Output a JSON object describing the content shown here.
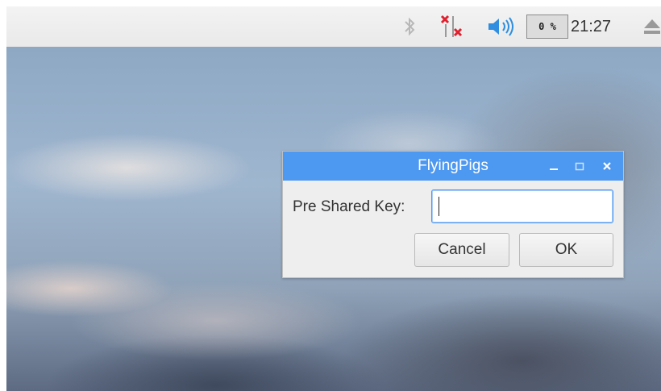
{
  "panel": {
    "bluetooth_icon": "bluetooth-icon",
    "network_icon": "network-disconnected-icon",
    "volume_icon": "volume-icon",
    "cpu_usage": "0 %",
    "clock": "21:27",
    "eject_icon": "eject-icon",
    "colors": {
      "network_x": "#e0202e",
      "volume": "#2f8ee0",
      "panel_bg": "#efefef"
    }
  },
  "dialog": {
    "title": "FlyingPigs",
    "label": "Pre Shared Key:",
    "input_value": "",
    "cancel_label": "Cancel",
    "ok_label": "OK",
    "colors": {
      "titlebar": "#4d98f0"
    }
  }
}
